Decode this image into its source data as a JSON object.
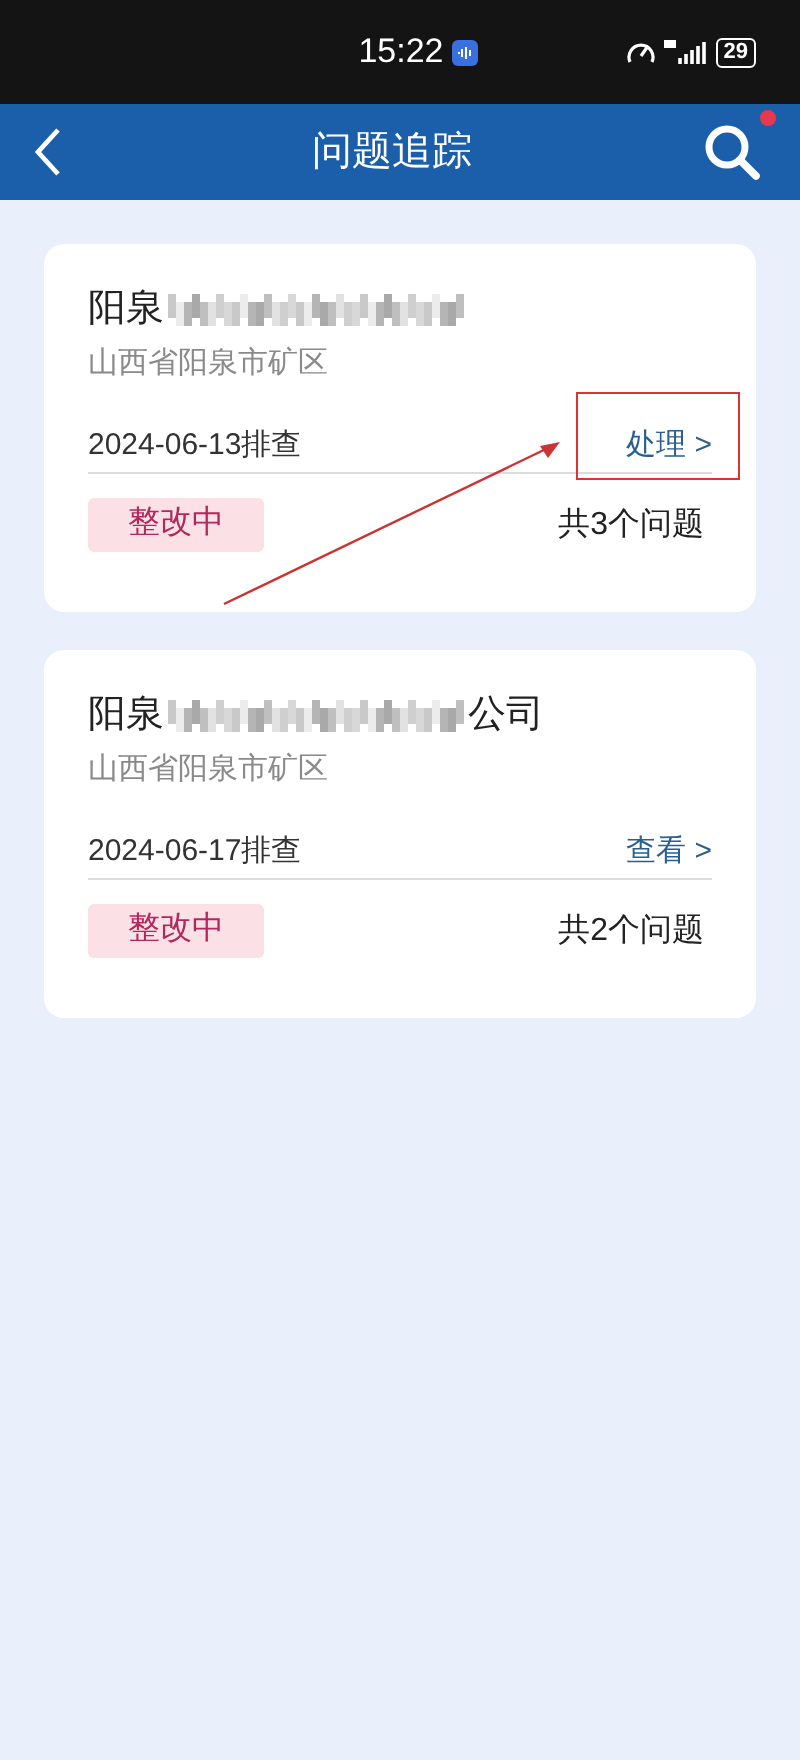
{
  "status_bar": {
    "time": "15:22",
    "battery": "29"
  },
  "header": {
    "title": "问题追踪",
    "search_has_notification": true
  },
  "cards": [
    {
      "name_start": "阳泉",
      "address": "山西省阳泉市矿区",
      "date": "2024-06-13排查",
      "action": "处理 >",
      "action_annotated": true,
      "status": "整改中",
      "count": "共3个问题"
    },
    {
      "name_start": "阳泉",
      "name_end": "公司",
      "address": "山西省阳泉市矿区",
      "date": "2024-06-17排查",
      "action": "查看 >",
      "action_annotated": false,
      "status": "整改中",
      "count": "共2个问题"
    }
  ]
}
